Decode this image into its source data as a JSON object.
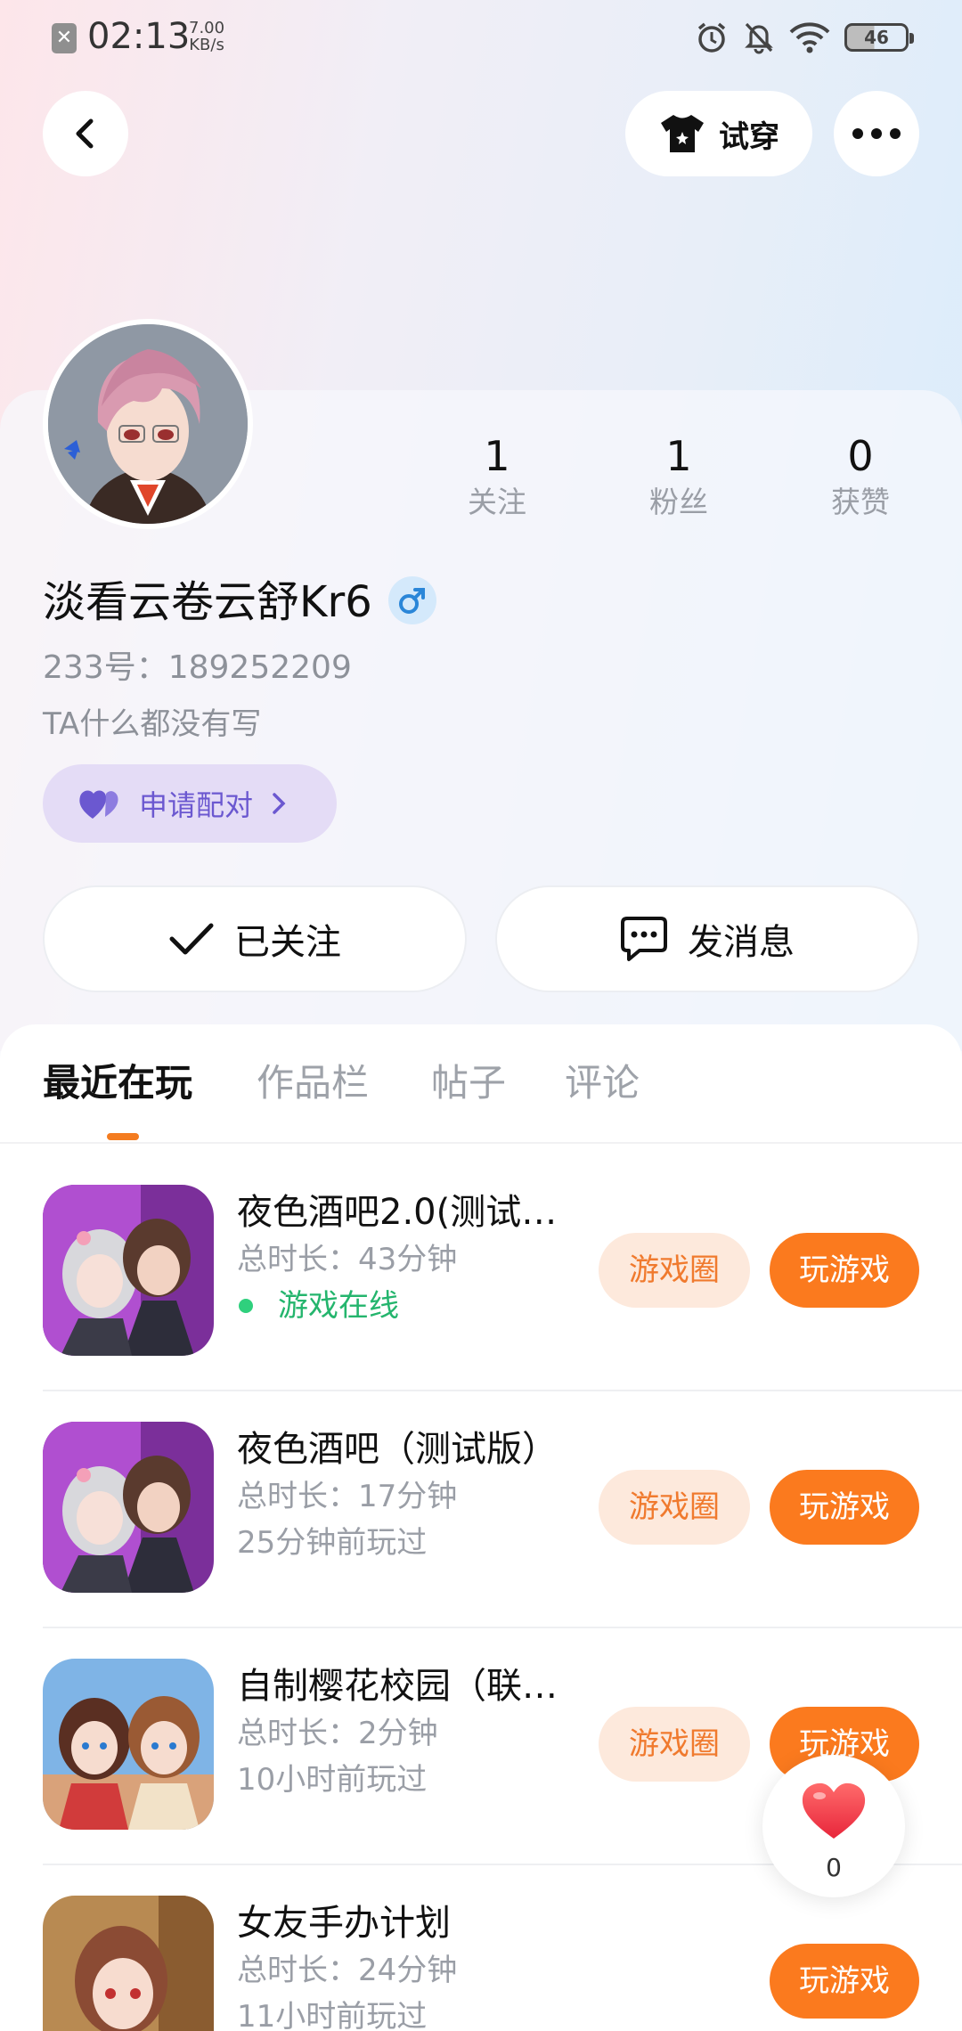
{
  "status_bar": {
    "time": "02:13",
    "speed_value": "7.00",
    "speed_unit": "KB/s",
    "battery": "46"
  },
  "header": {
    "try_on_label": "试穿"
  },
  "profile": {
    "username": "淡看云卷云舒Kr6",
    "uid": "233号：189252209",
    "bio": "TA什么都没有写",
    "pair_label": "申请配对",
    "stats": [
      {
        "value": "1",
        "label": "关注"
      },
      {
        "value": "1",
        "label": "粉丝"
      },
      {
        "value": "0",
        "label": "获赞"
      }
    ],
    "follow_label": "已关注",
    "message_label": "发消息"
  },
  "tabs": [
    {
      "label": "最近在玩",
      "active": true
    },
    {
      "label": "作品栏",
      "active": false
    },
    {
      "label": "帖子",
      "active": false
    },
    {
      "label": "评论",
      "active": false
    }
  ],
  "games": [
    {
      "title": "夜色酒吧2.0(测试…",
      "duration": "总时长：43分钟",
      "status": "游戏在线",
      "online": true,
      "circle_label": "游戏圈",
      "play_label": "玩游戏"
    },
    {
      "title": "夜色酒吧（测试版）",
      "duration": "总时长：17分钟",
      "status": "25分钟前玩过",
      "online": false,
      "circle_label": "游戏圈",
      "play_label": "玩游戏"
    },
    {
      "title": "自制樱花校园（联…",
      "duration": "总时长：2分钟",
      "status": "10小时前玩过",
      "online": false,
      "circle_label": "游戏圈",
      "play_label": "玩游戏"
    },
    {
      "title": "女友手办计划",
      "duration": "总时长：24分钟",
      "status": "11小时前玩过",
      "online": false,
      "circle_label": "",
      "play_label": "玩游戏"
    }
  ],
  "like_float": {
    "count": "0"
  },
  "colors": {
    "accent_orange": "#fb7a1e",
    "pair_purple": "#6b58d0",
    "online_green": "#24b56d"
  }
}
